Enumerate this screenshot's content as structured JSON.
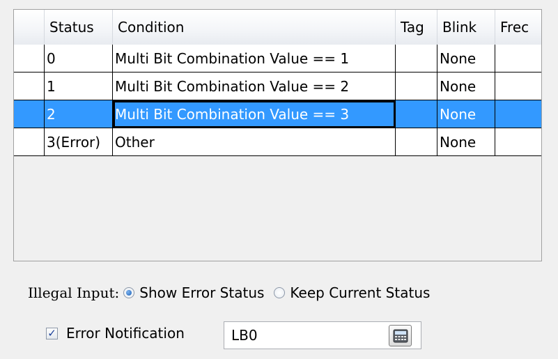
{
  "grid": {
    "columns": [
      "",
      "Status",
      "Condition",
      "Tag",
      "Blink",
      "Frec"
    ],
    "rows": [
      {
        "status": "0",
        "condition": "Multi Bit Combination Value == 1",
        "tag": "",
        "blink": "None",
        "freq": ""
      },
      {
        "status": "1",
        "condition": "Multi Bit Combination Value == 2",
        "tag": "",
        "blink": "None",
        "freq": ""
      },
      {
        "status": "2",
        "condition": "Multi Bit Combination Value == 3",
        "tag": "",
        "blink": "None",
        "freq": "",
        "selected": true
      },
      {
        "status": "3(Error)",
        "condition": "Other",
        "tag": "",
        "blink": "None",
        "freq": ""
      }
    ]
  },
  "illegal_input": {
    "label": "Illegal Input:",
    "options": [
      {
        "label": "Show Error Status",
        "checked": true
      },
      {
        "label": "Keep Current Status",
        "checked": false
      }
    ]
  },
  "error_notification": {
    "label": "Error Notification",
    "checked": true,
    "address": "LB0",
    "button_icon": "calculator-icon"
  },
  "colors": {
    "selection": "#3399ff",
    "window_bg": "#f0f0f0"
  }
}
